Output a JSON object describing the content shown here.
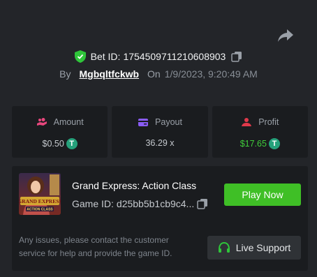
{
  "header": {
    "bet_id_label": "Bet ID:",
    "bet_id": "1754509711210608903",
    "by_label": "By",
    "username": "Mgbqltfckwb",
    "on_label": "On",
    "datetime": "1/9/2023, 9:20:49 AM"
  },
  "stats": {
    "amount": {
      "label": "Amount",
      "value": "$0.50",
      "icon": "hand-coins-icon",
      "icon_color": "#e8477d"
    },
    "payout": {
      "label": "Payout",
      "value": "36.29 x",
      "icon": "wallet-icon",
      "icon_color": "#8a5cf6"
    },
    "profit": {
      "label": "Profit",
      "value": "$17.65",
      "icon": "profit-person-icon",
      "icon_color": "#e0394a",
      "value_color": "#3fcc3a"
    }
  },
  "currency_symbol": "T",
  "game": {
    "title": "Grand Express: Action Class",
    "id_label": "Game ID:",
    "id_value": "d25bb5b1cb9c4...",
    "play_label": "Play Now",
    "thumbnail_text": "GRAND EXPRESS",
    "thumbnail_subtext": "ACTION CLASS"
  },
  "support": {
    "notice": "Any issues, please contact the customer service for help and provide the game ID.",
    "button_label": "Live Support"
  },
  "colors": {
    "background": "#232529",
    "card": "#1a1c1f",
    "accent_green": "#3fbf26",
    "shield": "#2fc53a",
    "tether": "#26a17b"
  }
}
